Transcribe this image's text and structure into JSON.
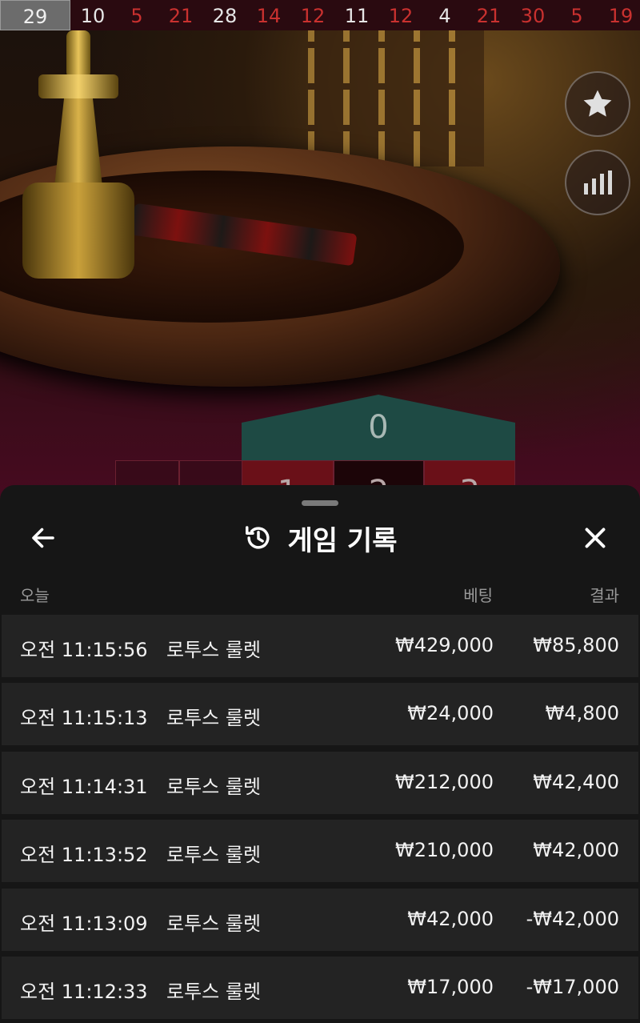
{
  "recent_results": [
    {
      "value": "29",
      "color": "latest"
    },
    {
      "value": "10",
      "color": "black"
    },
    {
      "value": "5",
      "color": "red"
    },
    {
      "value": "21",
      "color": "red"
    },
    {
      "value": "28",
      "color": "black"
    },
    {
      "value": "14",
      "color": "red"
    },
    {
      "value": "12",
      "color": "red"
    },
    {
      "value": "11",
      "color": "black"
    },
    {
      "value": "12",
      "color": "red"
    },
    {
      "value": "4",
      "color": "black"
    },
    {
      "value": "21",
      "color": "red"
    },
    {
      "value": "30",
      "color": "red"
    },
    {
      "value": "5",
      "color": "red"
    },
    {
      "value": "19",
      "color": "red"
    }
  ],
  "side_buttons": {
    "favorites_icon": "star-icon",
    "statistics_icon": "bar-chart-icon"
  },
  "betting_grid": {
    "zero": "0",
    "numbers": [
      "1",
      "2",
      "3"
    ],
    "partial_cell_label": "1"
  },
  "history": {
    "back_icon": "arrow-left-icon",
    "title_icon": "history-icon",
    "title": "게임 기록",
    "close_icon": "close-icon",
    "columns": {
      "date": "오늘",
      "bet": "베팅",
      "result": "결과"
    },
    "rows": [
      {
        "time": "오전 11:15:56",
        "game": "로투스 룰렛",
        "bet": "₩429,000",
        "result": "₩85,800"
      },
      {
        "time": "오전 11:15:13",
        "game": "로투스 룰렛",
        "bet": "₩24,000",
        "result": "₩4,800"
      },
      {
        "time": "오전 11:14:31",
        "game": "로투스 룰렛",
        "bet": "₩212,000",
        "result": "₩42,400"
      },
      {
        "time": "오전 11:13:52",
        "game": "로투스 룰렛",
        "bet": "₩210,000",
        "result": "₩42,000"
      },
      {
        "time": "오전 11:13:09",
        "game": "로투스 룰렛",
        "bet": "₩42,000",
        "result": "-₩42,000"
      },
      {
        "time": "오전 11:12:33",
        "game": "로투스 룰렛",
        "bet": "₩17,000",
        "result": "-₩17,000"
      }
    ]
  },
  "colors": {
    "red_number": "#c9312f",
    "zero_green": "#1e4a44",
    "sheet_bg": "#161616",
    "row_bg": "#232323"
  }
}
